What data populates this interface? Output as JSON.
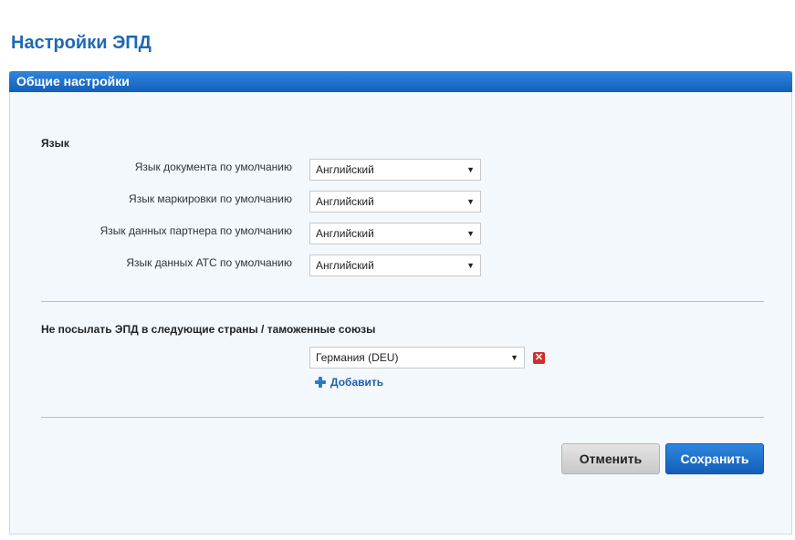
{
  "page": {
    "title": "Настройки ЭПД"
  },
  "panel": {
    "header": "Общие настройки"
  },
  "language_section": {
    "title": "Язык",
    "rows": [
      {
        "label": "Язык документа по умолчанию",
        "value": "Английский"
      },
      {
        "label": "Язык маркировки по умолчанию",
        "value": "Английский"
      },
      {
        "label": "Язык данных партнера по умолчанию",
        "value": "Английский"
      },
      {
        "label": "Язык данных АТС по умолчанию",
        "value": "Английский"
      }
    ]
  },
  "exclusion_section": {
    "title": "Не посылать ЭПД в следующие страны / таможенные союзы",
    "selected": "Германия (DEU)",
    "add_label": "Добавить"
  },
  "actions": {
    "cancel_label": "Отменить",
    "save_label": "Сохранить"
  },
  "icons": {
    "dropdown": "chevron-down-icon",
    "remove": "close-icon",
    "add": "plus-icon"
  },
  "colors": {
    "accent": "#1e69b4",
    "header_gradient_top": "#2f86de",
    "header_gradient_bottom": "#125fba",
    "remove": "#d62b2b",
    "panel_bg": "#f3f8fd"
  }
}
